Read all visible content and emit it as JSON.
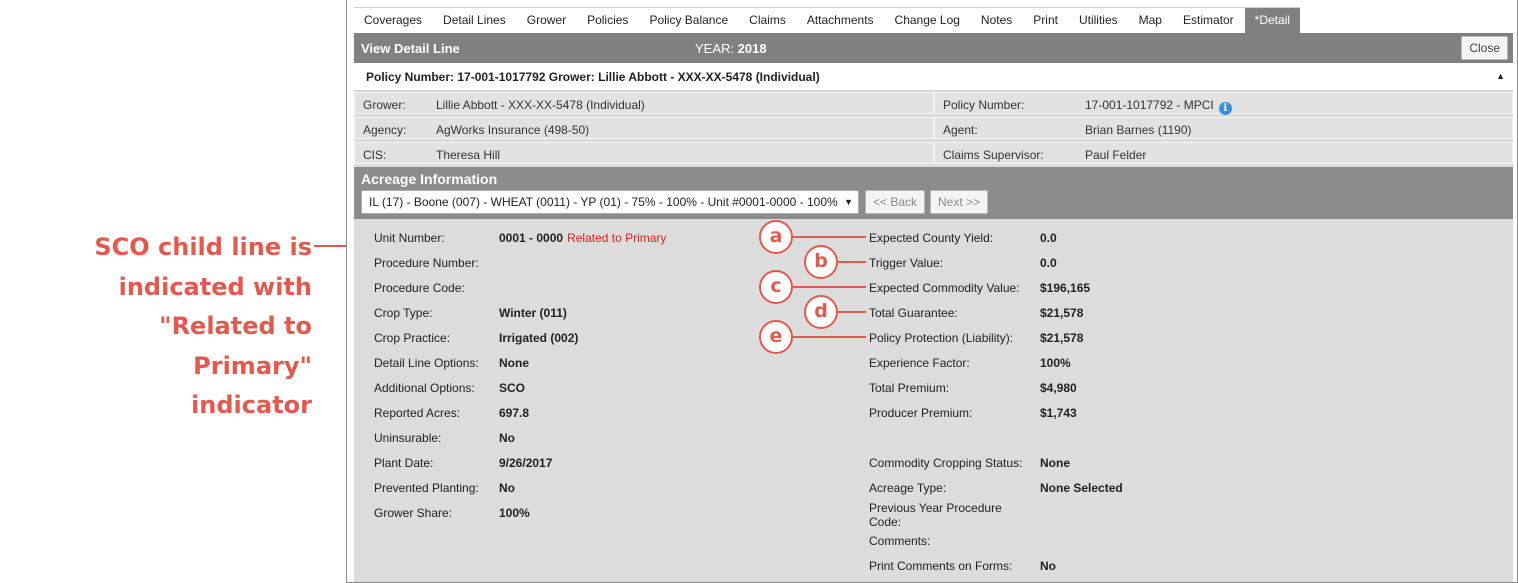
{
  "annotation": {
    "text_lines": [
      "SCO child line is",
      "indicated with",
      "\"Related to Primary\"",
      "indicator"
    ],
    "markers": [
      "a",
      "b",
      "c",
      "d",
      "e"
    ]
  },
  "tabs": [
    {
      "label": "Coverages",
      "active": false
    },
    {
      "label": "Detail Lines",
      "active": false
    },
    {
      "label": "Grower",
      "active": false
    },
    {
      "label": "Policies",
      "active": false
    },
    {
      "label": "Policy Balance",
      "active": false
    },
    {
      "label": "Claims",
      "active": false
    },
    {
      "label": "Attachments",
      "active": false
    },
    {
      "label": "Change Log",
      "active": false
    },
    {
      "label": "Notes",
      "active": false
    },
    {
      "label": "Print",
      "active": false
    },
    {
      "label": "Utilities",
      "active": false
    },
    {
      "label": "Map",
      "active": false
    },
    {
      "label": "Estimator",
      "active": false
    },
    {
      "label": "*Detail",
      "active": true
    }
  ],
  "header": {
    "title": "View Detail Line",
    "year_label": "YEAR:",
    "year_value": "2018",
    "close_label": "Close"
  },
  "policy_bar": {
    "text": "Policy Number: 17-001-1017792 Grower: Lillie Abbott - XXX-XX-5478 (Individual)",
    "collapse_glyph": "▲"
  },
  "info": {
    "grower_label": "Grower:",
    "grower_value": "Lillie Abbott - XXX-XX-5478 (Individual)",
    "policy_label": "Policy Number:",
    "policy_value": "17-001-1017792 - MPCI",
    "agency_label": "Agency:",
    "agency_value": "AgWorks Insurance (498-50)",
    "agent_label": "Agent:",
    "agent_value": "Brian Barnes (1190)",
    "cis_label": "CIS:",
    "cis_value": "Theresa Hill",
    "claims_label": "Claims Supervisor:",
    "claims_value": "Paul Felder"
  },
  "acreage": {
    "header": "Acreage Information",
    "selected_unit": "IL (17) - Boone (007) - WHEAT (0011) - YP (01) - 75% - 100% - Unit #0001-0000 - 100%",
    "back_label": "<< Back",
    "next_label": "Next >>"
  },
  "left_fields": [
    {
      "label": "Unit Number:",
      "value": "0001 - 0000",
      "extra": "Related to Primary"
    },
    {
      "label": "Procedure Number:",
      "value": ""
    },
    {
      "label": "Procedure Code:",
      "value": ""
    },
    {
      "label": "Crop Type:",
      "value": "Winter (011)"
    },
    {
      "label": "Crop Practice:",
      "value": "Irrigated (002)"
    },
    {
      "label": "Detail Line Options:",
      "value": "None"
    },
    {
      "label": "Additional Options:",
      "value": "SCO"
    },
    {
      "label": "Reported Acres:",
      "value": "697.8"
    },
    {
      "label": "Uninsurable:",
      "value": "No"
    },
    {
      "label": "Plant Date:",
      "value": "9/26/2017"
    },
    {
      "label": "Prevented Planting:",
      "value": "No"
    },
    {
      "label": "Grower Share:",
      "value": "100%"
    }
  ],
  "right_fields": [
    {
      "label": "Expected County Yield:",
      "value": "0.0"
    },
    {
      "label": "Trigger Value:",
      "value": "0.0"
    },
    {
      "label": "Expected Commodity Value:",
      "value": "$196,165"
    },
    {
      "label": "Total Guarantee:",
      "value": "$21,578"
    },
    {
      "label": "Policy Protection (Liability):",
      "value": "$21,578"
    },
    {
      "label": "Experience Factor:",
      "value": "100%"
    },
    {
      "label": "Total Premium:",
      "value": "$4,980"
    },
    {
      "label": "Producer Premium:",
      "value": "$1,743"
    },
    {
      "label": "Commodity Cropping Status:",
      "value": "None"
    },
    {
      "label": "Acreage Type:",
      "value": "None Selected"
    },
    {
      "label": "Previous Year Procedure",
      "label2": "Code:",
      "value": ""
    },
    {
      "label": "Comments:",
      "value": ""
    },
    {
      "label": "Print Comments on Forms:",
      "value": "No"
    }
  ],
  "colors": {
    "annotation": "#e05a4f",
    "header_bg": "#808080",
    "panel_bg": "#dcdcdc",
    "related_text": "#dd1f1f",
    "info_icon": "#3a8fd6"
  }
}
